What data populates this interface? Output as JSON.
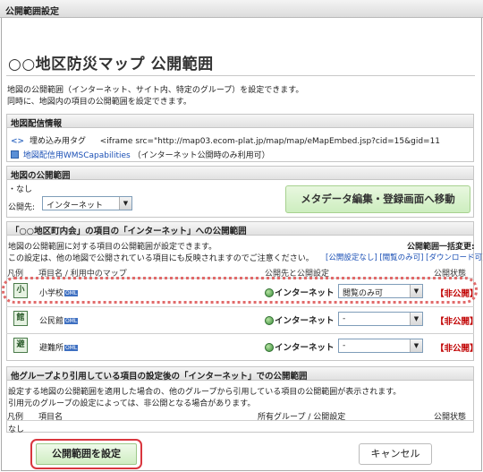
{
  "window": {
    "title": "公開範囲設定"
  },
  "page": {
    "title": "○○地区防災マップ 公開範囲",
    "intro_line1": "地図の公開範囲（インターネット、サイト内、特定のグループ）を設定できます。",
    "intro_line2": "同時に、地図内の項目の公開範囲を設定できます。"
  },
  "distribution": {
    "header": "地図配信情報",
    "embed_label": "埋め込み用タグ",
    "embed_value": "<iframe src=\"http://map03.ecom-plat.jp/map/map/eMapEmbed.jsp?cid=15&gid=11",
    "wms_link": "地図配信用WMSCapabilities",
    "wms_note": "（インターネット公開時のみ利用可）"
  },
  "map_scope": {
    "header": "地図の公開範囲",
    "none_text": "・なし",
    "scope_label": "公開先:",
    "scope_value": "インターネット",
    "meta_button": "メタデータ編集・登録画面へ移動"
  },
  "items_scope": {
    "header": "「○○地区町内会」の項目の「インターネット」への公開範囲",
    "desc1": "地図の公開範囲に対する項目の公開範囲が設定できます。",
    "desc2": "この設定は、他の地図で公開されている項目にも反映されますのでご注意ください。",
    "bulk_label": "公開範囲一括変更:",
    "bulk_links": "[公開設定なし] [閲覧のみ可] [ダウンロード可]",
    "col_legend": "凡例",
    "col_name": "項目名 / 利用中のマップ",
    "col_target": "公開先と公開設定",
    "col_status": "公開状態",
    "rows": [
      {
        "icon": "school-icon",
        "name": "小学校",
        "badge": "OML",
        "target": "インターネット",
        "setting": "閲覧のみ可",
        "status": "【非公開】"
      },
      {
        "icon": "community-hall-icon",
        "name": "公民館",
        "badge": "OML",
        "target": "インターネット",
        "setting": "-",
        "status": "【非公開】"
      },
      {
        "icon": "shelter-icon",
        "name": "避難所",
        "badge": "OML",
        "target": "インターネット",
        "setting": "-",
        "status": "【非公開】"
      }
    ]
  },
  "ref_scope": {
    "header": "他グループより引用している項目の設定後の「インターネット」での公開範囲",
    "desc1": "設定する地図の公開範囲を適用した場合の、他のグループから引用している項目の公開範囲が表示されます。",
    "desc2": "引用元のグループの設定によっては、非公開となる場合があります。",
    "col_legend": "凡例",
    "col_name": "項目名",
    "col_group": "所有グループ / 公開設定",
    "col_status": "公開状態",
    "none_text": "なし"
  },
  "footer": {
    "submit_label": "公開範囲を設定",
    "cancel_label": "キャンセル"
  },
  "colors": {
    "status_red": "#c00000",
    "highlight_ring": "#e16a6a",
    "button_green": "#cfedc2",
    "link_blue": "#1a4fb5"
  }
}
